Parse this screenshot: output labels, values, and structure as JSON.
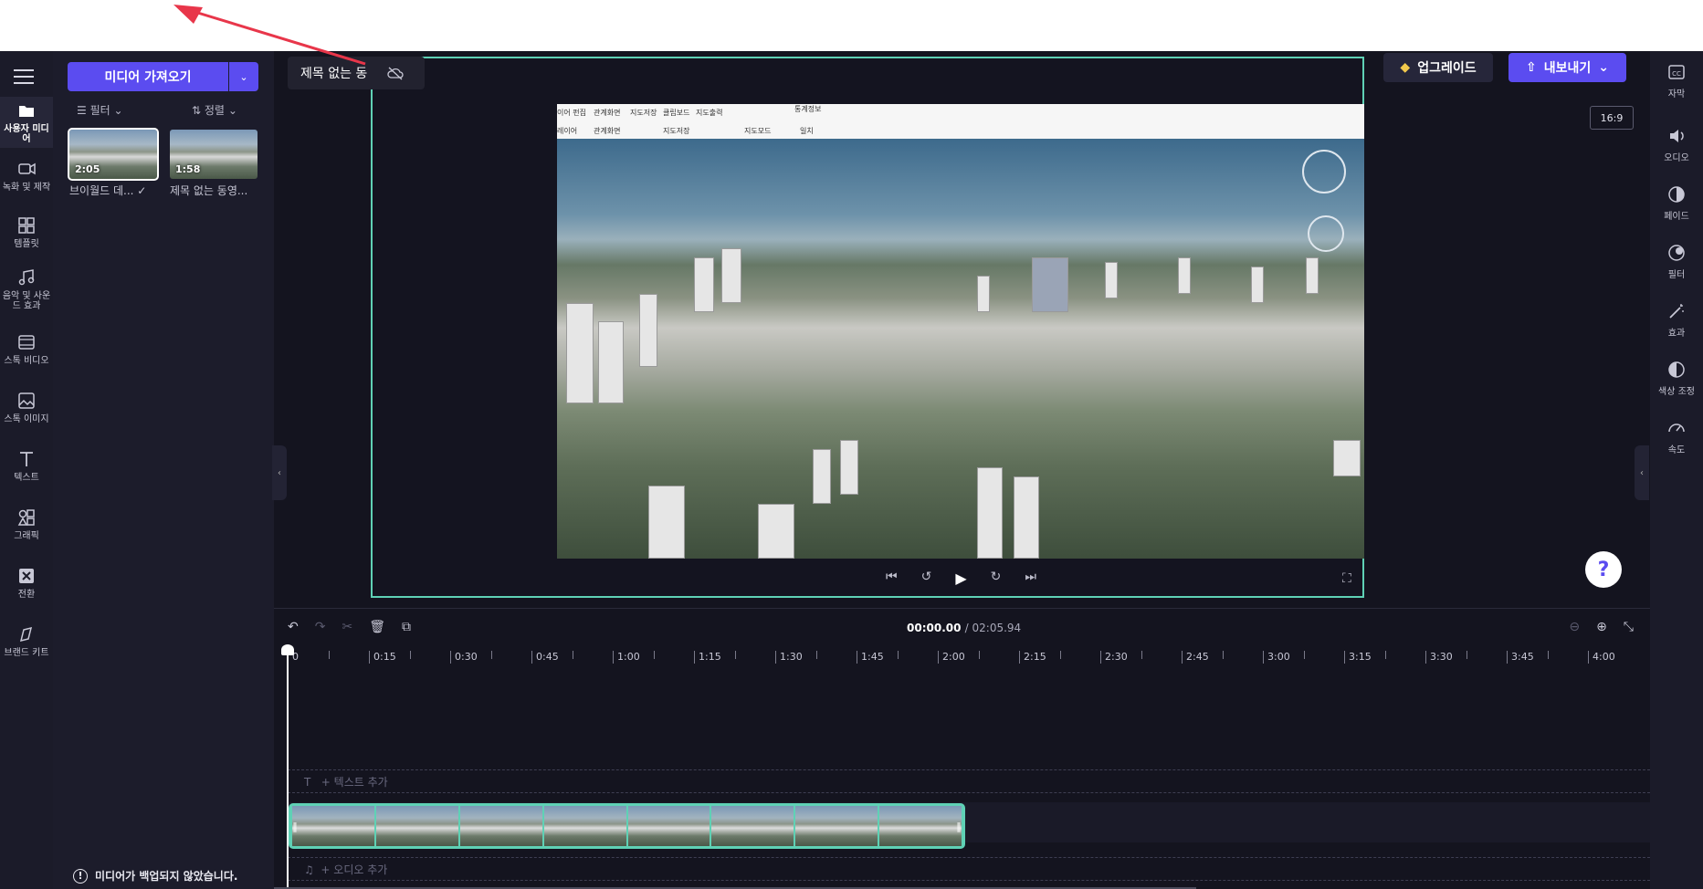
{
  "app": {
    "title": "제목 없는 동",
    "import_button": "미디어 가져오기",
    "filter_label": "필터",
    "sort_label": "정렬",
    "upgrade_label": "업그레이드",
    "export_label": "내보내기",
    "aspect_ratio": "16:9",
    "backup_warning": "미디어가 백업되지 않았습니다.",
    "help_label": "?"
  },
  "left_rail": [
    {
      "label": "사용자 미디어",
      "icon": "folder-icon",
      "active": true
    },
    {
      "label": "녹화 및 제작",
      "icon": "camera-icon"
    },
    {
      "label": "템플릿",
      "icon": "template-icon"
    },
    {
      "label": "음악 및 사운드 효과",
      "icon": "music-icon"
    },
    {
      "label": "스톡 비디오",
      "icon": "film-icon"
    },
    {
      "label": "스톡 이미지",
      "icon": "image-icon"
    },
    {
      "label": "텍스트",
      "icon": "text-icon"
    },
    {
      "label": "그래픽",
      "icon": "shapes-icon"
    },
    {
      "label": "전환",
      "icon": "transition-icon"
    },
    {
      "label": "브랜드 키트",
      "icon": "brand-icon"
    }
  ],
  "media_items": [
    {
      "label": "브이월드 데...",
      "duration": "2:05"
    },
    {
      "label": "제목 없는 동영...",
      "duration": "1:58"
    }
  ],
  "right_rail": [
    {
      "label": "자막",
      "icon": "cc-icon"
    },
    {
      "label": "오디오",
      "icon": "speaker-icon"
    },
    {
      "label": "페이드",
      "icon": "fade-icon"
    },
    {
      "label": "필터",
      "icon": "filter-icon"
    },
    {
      "label": "효과",
      "icon": "magic-wand-icon"
    },
    {
      "label": "색상 조정",
      "icon": "color-adjust-icon"
    },
    {
      "label": "속도",
      "icon": "speed-icon"
    }
  ],
  "video_menu": {
    "row1": [
      "이어 펀집",
      "관계화면",
      "지도저장",
      "클립보드",
      "지도출력",
      "통계정보"
    ],
    "row2": [
      "레이어",
      "관계화면",
      "지도저장",
      "지도모드",
      "일치"
    ]
  },
  "timeline": {
    "current_time": "00:00.00",
    "total_time": "/ 02:05.94",
    "ticks": [
      "0",
      "0:15",
      "0:30",
      "0:45",
      "1:00",
      "1:15",
      "1:30",
      "1:45",
      "2:00",
      "2:15",
      "2:30",
      "2:45",
      "3:00",
      "3:15",
      "3:30",
      "3:45",
      "4:00"
    ],
    "add_text": "+ 텍스트 추가",
    "add_audio": "+ 오디오 추가"
  },
  "colors": {
    "accent": "#5b4cf0",
    "selection": "#5fd1b5",
    "annotation_arrow": "#e8364a"
  }
}
